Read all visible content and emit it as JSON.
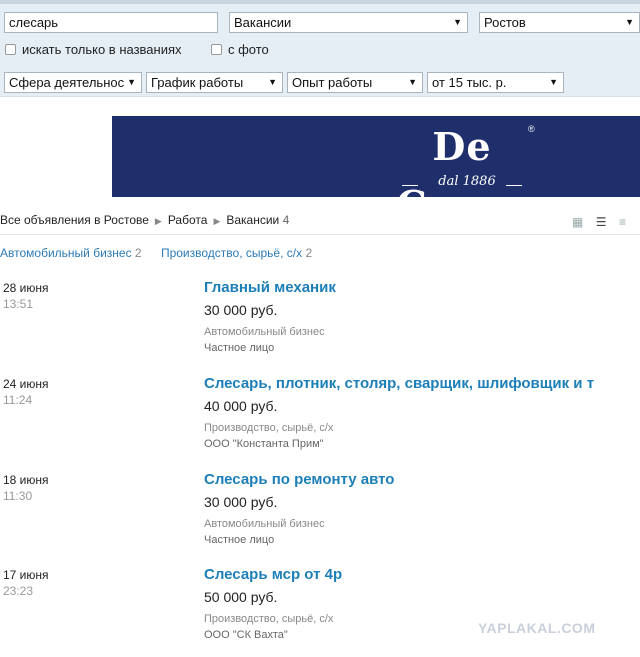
{
  "filters": {
    "search_value": "слесарь",
    "section_value": "Вакансии",
    "city_value": "Ростов",
    "only_titles_label": "искать только в названиях",
    "with_photo_label": "с фото",
    "sphere_value": "Сфера деятельнос",
    "schedule_value": "График работы",
    "experience_value": "Опыт работы",
    "salary_value": "от 15 тыс. р."
  },
  "banner": {
    "brand": "De Cecco",
    "registered": "®",
    "tagline": "dal 1886"
  },
  "breadcrumb": {
    "item1": "Все объявления в Ростове",
    "item2": "Работа",
    "item3": "Вакансии",
    "count": "4"
  },
  "categories": [
    {
      "label": "Автомобильный бизнес",
      "count": "2"
    },
    {
      "label": "Производство, сырьё, с/х",
      "count": "2"
    }
  ],
  "listings": [
    {
      "date": "28 июня",
      "time": "13:51",
      "title": "Главный механик",
      "price": "30 000 руб.",
      "category": "Автомобильный бизнес",
      "company": "Частное лицо"
    },
    {
      "date": "24 июня",
      "time": "11:24",
      "title": "Слесарь, плотник, столяр, сварщик, шлифовщик и т",
      "price": "40 000 руб.",
      "category": "Производство, сырьё, с/х",
      "company": "ООО \"Константа Прим\""
    },
    {
      "date": "18 июня",
      "time": "11:30",
      "title": "Слесарь по ремонту авто",
      "price": "30 000 руб.",
      "category": "Автомобильный бизнес",
      "company": "Частное лицо"
    },
    {
      "date": "17 июня",
      "time": "23:23",
      "title": "Слесарь мср от 4р",
      "price": "50 000 руб.",
      "category": "Производство, сырьё, с/х",
      "company": "ООО \"СК Вахта\""
    }
  ],
  "watermark": "YAPLAKAL.COM",
  "icons": {
    "dropdown": "▼",
    "separator": "▶",
    "view_gallery": "▦",
    "view_list": "☰",
    "view_compact": "≡"
  },
  "colors": {
    "link": "#1d7fb8",
    "banner_bg": "#1f2f6c",
    "filter_bg": "#e6eef5"
  }
}
